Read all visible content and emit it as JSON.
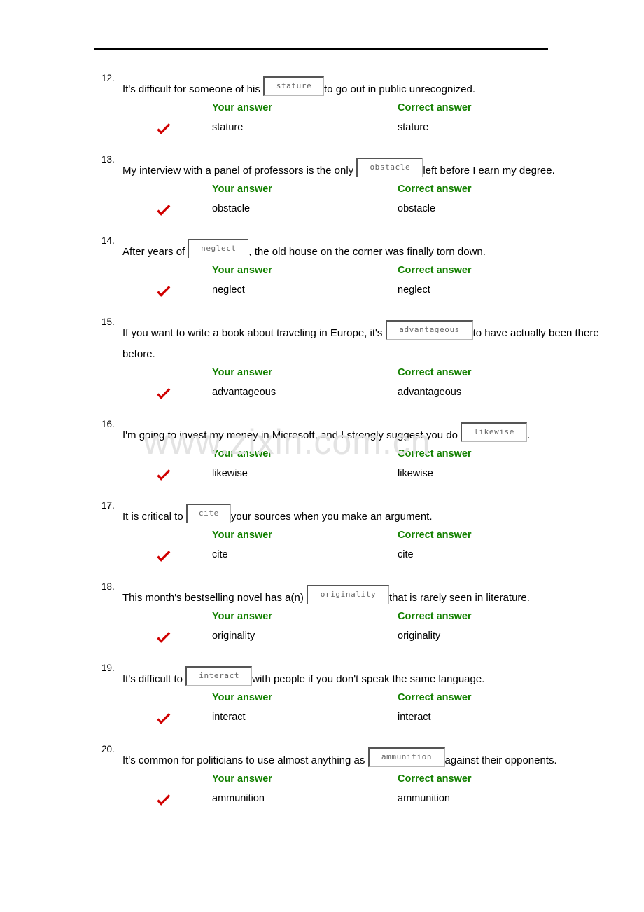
{
  "page": {
    "watermark": "www.zixin.com.cn",
    "rule_color": "#000000",
    "answer_header_color": "#138000",
    "check_color": "#d00000",
    "blank_text_color": "#666666"
  },
  "labels": {
    "your_answer": "Your answer",
    "correct_answer": "Correct answer",
    "check_icon": "check-mark"
  },
  "questions": [
    {
      "number": "12.",
      "before": "It's difficult for someone of his ",
      "blank": "stature",
      "after": "to go out in public unrecognized.",
      "your_answer": "stature",
      "correct_answer": "stature",
      "is_correct": true
    },
    {
      "number": "13.",
      "before": "My interview with a panel of professors is the only ",
      "blank": "obstacle",
      "after": "left before I earn my degree.",
      "your_answer": "obstacle",
      "correct_answer": "obstacle",
      "is_correct": true
    },
    {
      "number": "14.",
      "before": "After years of ",
      "blank": "neglect",
      "after": ", the old house on the corner was finally torn down.",
      "your_answer": "neglect",
      "correct_answer": "neglect",
      "is_correct": true
    },
    {
      "number": "15.",
      "before": "If you want to write a book about traveling in Europe, it's ",
      "blank": "advantageous",
      "after": "to have actually been there before.",
      "your_answer": "advantageous",
      "correct_answer": "advantageous",
      "is_correct": true
    },
    {
      "number": "16.",
      "before": "I'm going to invest my money in Microsoft, and I strongly suggest you do ",
      "blank": "likewise",
      "after": ".",
      "your_answer": "likewise",
      "correct_answer": "likewise",
      "is_correct": true
    },
    {
      "number": "17.",
      "before": "It is critical to ",
      "blank": "cite",
      "after": "your sources when you make an argument.",
      "your_answer": "cite",
      "correct_answer": "cite",
      "is_correct": true
    },
    {
      "number": "18.",
      "before": "This month's bestselling novel has a(n) ",
      "blank": "originality",
      "after": "that is rarely seen in literature.",
      "your_answer": "originality",
      "correct_answer": "originality",
      "is_correct": true
    },
    {
      "number": "19.",
      "before": "It's difficult to ",
      "blank": "interact",
      "after": "with people if you don't speak the same language.",
      "your_answer": "interact",
      "correct_answer": "interact",
      "is_correct": true
    },
    {
      "number": "20.",
      "before": "It's common for politicians to use almost anything as ",
      "blank": "ammunition",
      "after": "against their opponents.",
      "your_answer": "ammunition",
      "correct_answer": "ammunition",
      "is_correct": true
    }
  ]
}
